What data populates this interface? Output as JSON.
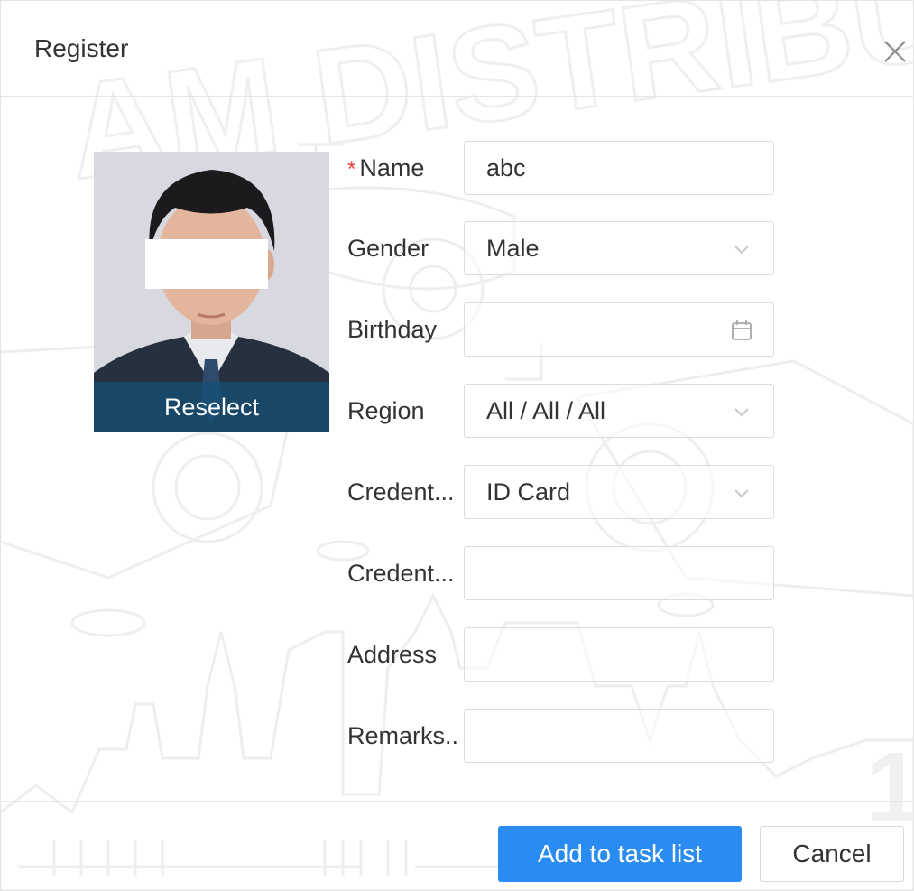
{
  "dialog": {
    "title": "Register",
    "close_icon": "close-icon"
  },
  "photo": {
    "reselect_label": "Reselect"
  },
  "form": {
    "name": {
      "label": "Name",
      "required_mark": "*",
      "value": "abc"
    },
    "gender": {
      "label": "Gender",
      "value": "Male",
      "icon": "chevron-down-icon"
    },
    "birthday": {
      "label": "Birthday",
      "value": "",
      "icon": "calendar-icon"
    },
    "region": {
      "label": "Region",
      "value": "All / All / All",
      "icon": "chevron-down-icon"
    },
    "credential_type": {
      "label": "Credent...",
      "value": "ID Card",
      "icon": "chevron-down-icon"
    },
    "credential_no": {
      "label": "Credent...",
      "value": ""
    },
    "address": {
      "label": "Address",
      "value": ""
    },
    "remarks": {
      "label": "Remarks..",
      "value": ""
    }
  },
  "footer": {
    "add_label": "Add to task list",
    "cancel_label": "Cancel"
  },
  "colors": {
    "primary": "#2a8cf0",
    "required": "#e03c3c",
    "watermark": "#efefef"
  }
}
